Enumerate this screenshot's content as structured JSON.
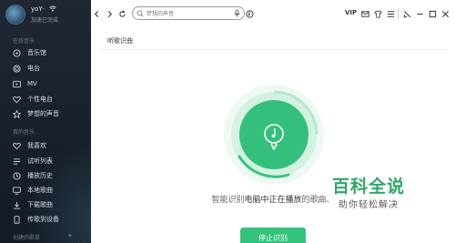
{
  "user": {
    "name": "yoY·",
    "status": "加速已完成"
  },
  "sidebar": {
    "online_title": "在线音乐",
    "online_items": [
      {
        "label": "音乐馆",
        "icon": "music-hall-icon"
      },
      {
        "label": "电台",
        "icon": "radio-icon"
      },
      {
        "label": "MV",
        "icon": "mv-icon"
      },
      {
        "label": "个性电台",
        "icon": "heart-radio-icon"
      },
      {
        "label": "梦想的声音",
        "icon": "star-icon"
      }
    ],
    "mine_title": "我的音乐",
    "mine_items": [
      {
        "label": "我喜欢",
        "icon": "heart-icon"
      },
      {
        "label": "试听列表",
        "icon": "list-icon"
      },
      {
        "label": "播放历史",
        "icon": "history-icon"
      },
      {
        "label": "本地歌曲",
        "icon": "computer-icon"
      },
      {
        "label": "下载歌曲",
        "icon": "download-icon"
      },
      {
        "label": "传歌到设备",
        "icon": "device-icon"
      }
    ],
    "playlist_title": "创建的歌单"
  },
  "topbar": {
    "search_placeholder": "梦想的声音",
    "vip_label": "VIP",
    "icons": [
      "back-icon",
      "forward-icon",
      "refresh-icon",
      "search-icon",
      "mic-icon",
      "recognize-icon",
      "mail-icon",
      "skin-icon",
      "settings-icon",
      "minimize-icon",
      "mini-mode-icon",
      "maximize-icon",
      "close-icon"
    ]
  },
  "main": {
    "title": "听歌识曲",
    "status_prefix": "智能识别",
    "status_highlight": "电脑中正在播放",
    "status_suffix": "的歌曲、",
    "stop_label": "停止识别"
  },
  "watermark": {
    "title": "百科全说",
    "subtitle": "助你轻松解决"
  },
  "colors": {
    "accent": "#31c27c",
    "sidebar_bg": "#1b232d",
    "watermark": "#2fa768"
  }
}
